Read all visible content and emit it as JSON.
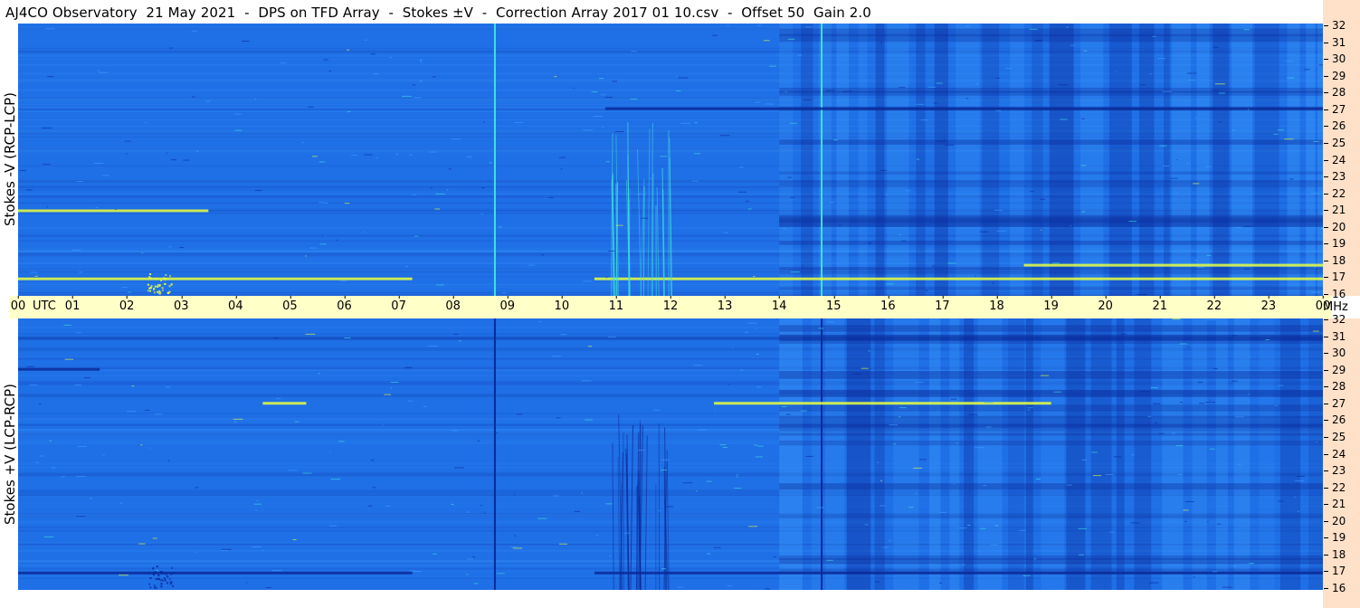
{
  "title": "AJ4CO Observatory  21 May 2021  -  DPS on TFD Array  -  Stokes ±V  -  Correction Array 2017 01 10.csv  -  Offset 50  Gain 2.0",
  "panels": {
    "top_label": "Stokes -V (RCP-LCP)",
    "bottom_label": "Stokes +V (LCP-RCP)"
  },
  "axes": {
    "time_unit": "UTC",
    "freq_unit": "MHz",
    "time_ticks": [
      "00",
      "01",
      "02",
      "03",
      "04",
      "05",
      "06",
      "07",
      "08",
      "09",
      "10",
      "11",
      "12",
      "13",
      "14",
      "15",
      "16",
      "17",
      "18",
      "19",
      "20",
      "21",
      "22",
      "23",
      "00"
    ],
    "freq_ticks": [
      "32",
      "31",
      "30",
      "29",
      "28",
      "27",
      "26",
      "25",
      "24",
      "23",
      "22",
      "21",
      "20",
      "19",
      "18",
      "17",
      "16"
    ]
  },
  "colors": {
    "background_blue": "#1f6fe6",
    "dark_blue": "#0a2a9a",
    "light_blue": "#3fa0ff",
    "cyan": "#40e0e0",
    "yellow": "#e8ff40",
    "time_axis_bg": "#ffffc8",
    "freq_axis_bg": "#ffe0c8"
  },
  "chart_data": [
    {
      "type": "heatmap",
      "name": "Stokes -V (RCP-LCP)",
      "x": "time UTC (hours)",
      "y": "frequency (MHz)",
      "xlim": [
        0,
        24
      ],
      "ylim": [
        16,
        32
      ],
      "background_level": "medium blue",
      "features": [
        {
          "kind": "vertical_line",
          "time": 8.77,
          "color": "cyan"
        },
        {
          "kind": "vertical_line",
          "time": 14.78,
          "color": "cyan"
        },
        {
          "kind": "horizontal_band",
          "freq": 17.0,
          "t_start": 0.0,
          "t_end": 7.25,
          "color": "yellow"
        },
        {
          "kind": "horizontal_band",
          "freq": 17.0,
          "t_start": 10.6,
          "t_end": 24.0,
          "color": "yellow"
        },
        {
          "kind": "horizontal_band",
          "freq": 27.0,
          "t_start": 10.8,
          "t_end": 24.0,
          "color": "dark_blue"
        },
        {
          "kind": "horizontal_band",
          "freq": 21.0,
          "t_start": 0.0,
          "t_end": 3.5,
          "color": "yellow"
        },
        {
          "kind": "horizontal_band",
          "freq": 17.8,
          "t_start": 18.5,
          "t_end": 24.0,
          "color": "yellow"
        },
        {
          "kind": "burst_region",
          "t_start": 10.9,
          "t_end": 12.0,
          "f_start": 16.0,
          "f_end": 26.5,
          "color": "cyan"
        },
        {
          "kind": "cluster",
          "time": 2.6,
          "freq": 16.8,
          "color": "yellow"
        },
        {
          "kind": "checker_region",
          "t_start": 14.0,
          "t_end": 24.0,
          "f_start": 16.0,
          "f_end": 32.0
        }
      ]
    },
    {
      "type": "heatmap",
      "name": "Stokes +V (LCP-RCP)",
      "x": "time UTC (hours)",
      "y": "frequency (MHz)",
      "xlim": [
        0,
        24
      ],
      "ylim": [
        16,
        32
      ],
      "background_level": "medium blue",
      "features": [
        {
          "kind": "vertical_line",
          "time": 8.77,
          "color": "dark_blue"
        },
        {
          "kind": "vertical_line",
          "time": 14.78,
          "color": "dark_blue"
        },
        {
          "kind": "horizontal_band",
          "freq": 17.0,
          "t_start": 0.0,
          "t_end": 7.25,
          "color": "dark_blue"
        },
        {
          "kind": "horizontal_band",
          "freq": 17.0,
          "t_start": 10.6,
          "t_end": 24.0,
          "color": "dark_blue"
        },
        {
          "kind": "horizontal_band",
          "freq": 27.0,
          "t_start": 4.5,
          "t_end": 5.3,
          "color": "yellow"
        },
        {
          "kind": "horizontal_band",
          "freq": 27.0,
          "t_start": 12.8,
          "t_end": 19.0,
          "color": "yellow"
        },
        {
          "kind": "horizontal_band",
          "freq": 29.0,
          "t_start": 0.0,
          "t_end": 1.5,
          "color": "dark_blue"
        },
        {
          "kind": "burst_region",
          "t_start": 10.9,
          "t_end": 12.0,
          "f_start": 16.0,
          "f_end": 26.5,
          "color": "dark_blue"
        },
        {
          "kind": "cluster",
          "time": 2.6,
          "freq": 16.8,
          "color": "dark_blue"
        },
        {
          "kind": "checker_region",
          "t_start": 14.0,
          "t_end": 24.0,
          "f_start": 16.0,
          "f_end": 32.0
        }
      ]
    }
  ]
}
